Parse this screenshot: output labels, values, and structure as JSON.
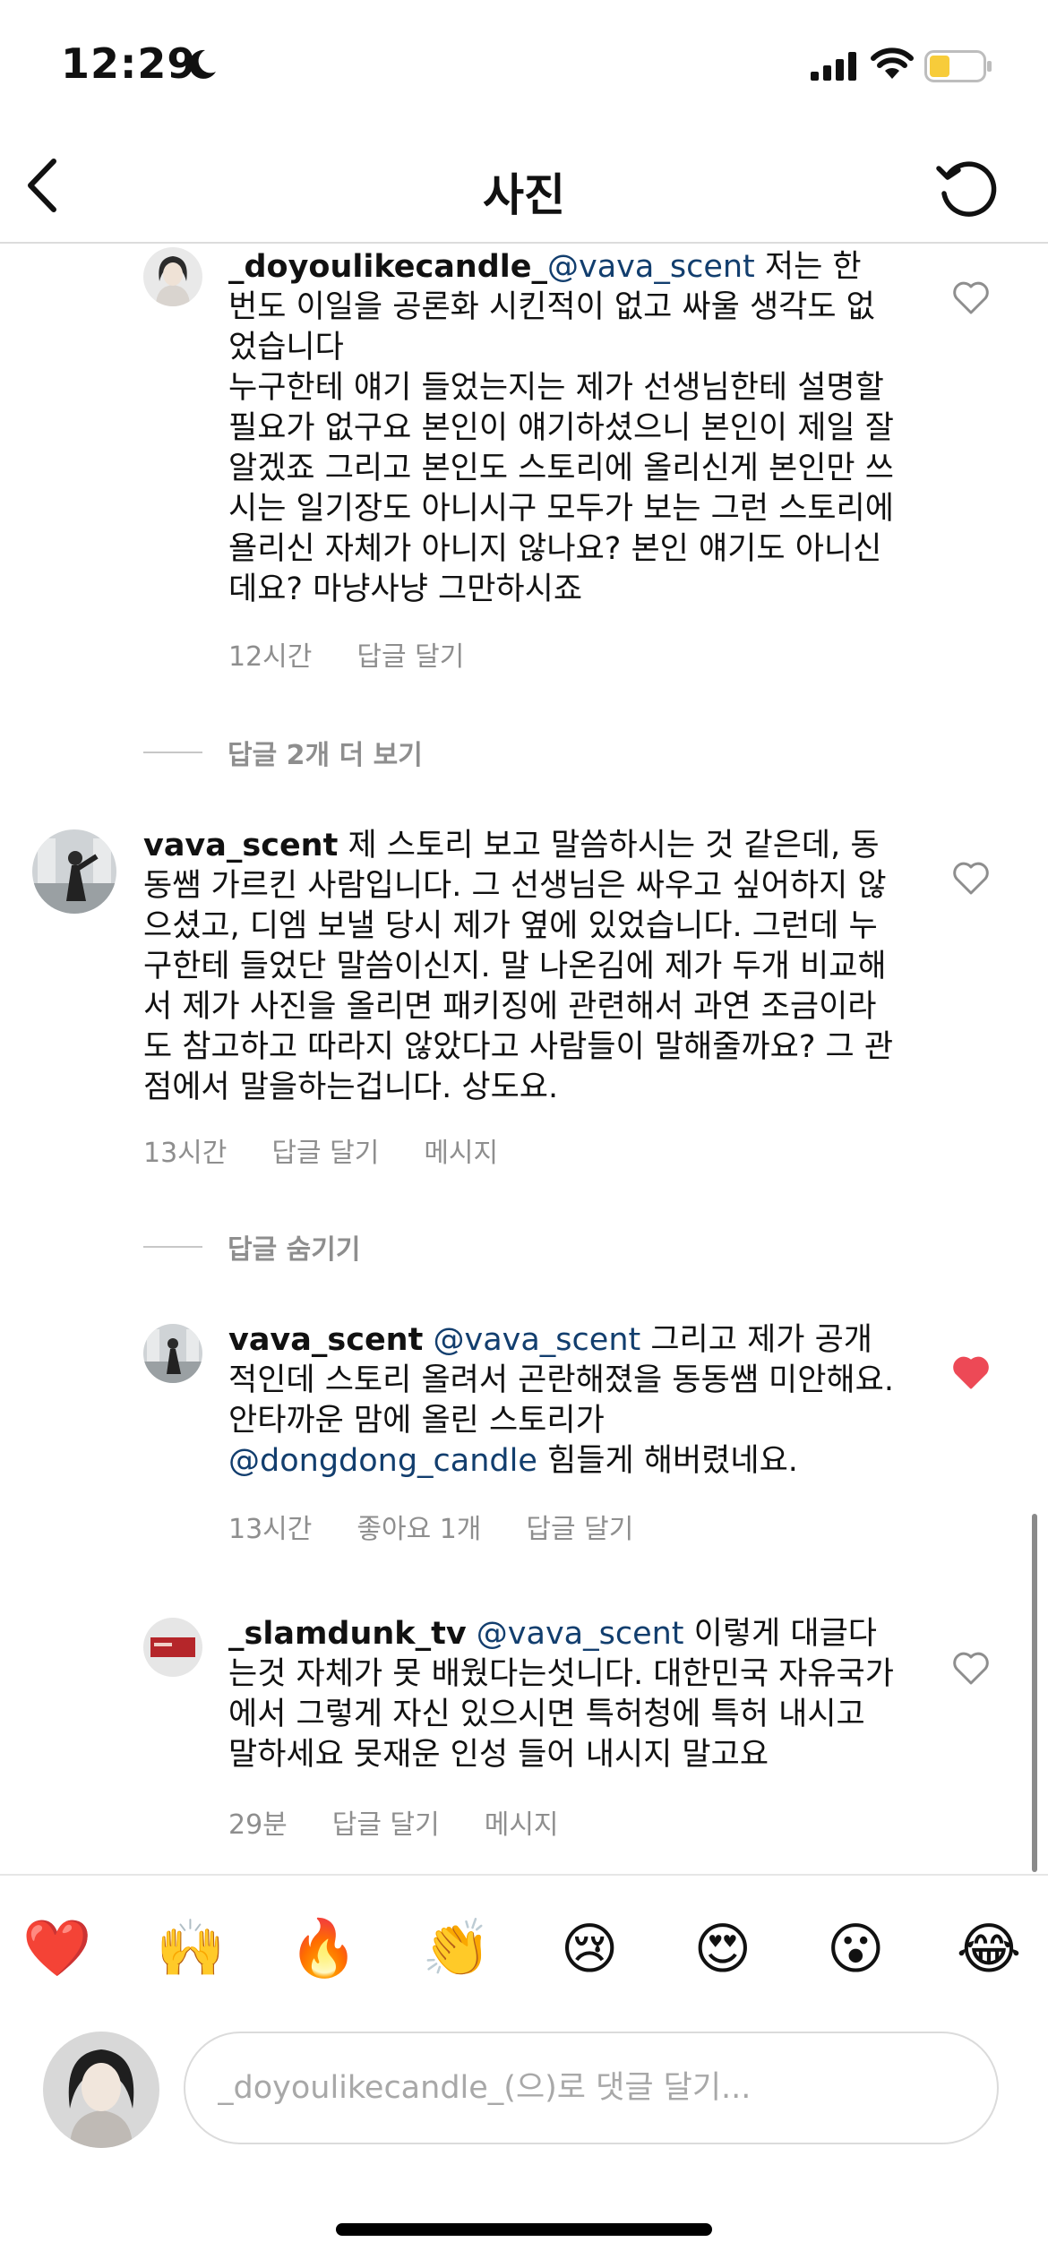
{
  "status_bar": {
    "time": "12:29"
  },
  "nav": {
    "title": "사진"
  },
  "comments": [
    {
      "username": "_doyoulikecandle_",
      "mention": "@vava_scent",
      "text_line1": " 저는 한",
      "text_rest": "번도 이일을 공론화 시킨적이 없고 싸울 생각도 없었습니다",
      "text_para2": "누구한테 얘기 들었는지는 제가 선생님한테 설명할 필요가 없구요 본인이 얘기하셨으니 본인이 제일 잘 알겠죠 그리고 본인도 스토리에 올리신게 본인만 쓰시는 일기장도 아니시구 모두가 보는 그런 스토리에 욜리신 자체가 아니지 않나요? 본인 얘기도 아니신데요? 마냥사냥 그만하시죠",
      "time": "12시간",
      "reply_label": "답글 달기",
      "liked": false
    },
    {
      "username": "vava_scent",
      "text": " 제 스토리 보고 말씀하시는 것 같은데, 동동쌤 가르킨 사람입니다. 그 선생님은 싸우고 싶어하지 않으셨고, 디엠 보낼 당시 제가 옆에 있었습니다. 그런데 누구한테 들었단 말씀이신지. 말 나온김에 제가 두개 비교해서 제가 사진을 올리면 패키징에 관련해서 과연 조금이라도 참고하고 따라지 않았다고 사람들이 말해줄까요? 그 관점에서 말을하는겁니다. 상도요.",
      "time": "13시간",
      "reply_label": "답글 달기",
      "message_label": "메시지",
      "liked": false
    },
    {
      "username": "vava_scent",
      "mention": "@vava_scent",
      "text": " 그리고 제가 공개적인데 스토리 올려서 곤란해졌을 동동쌤 미안해요. 안타까운 맘에 올린 스토리가 ",
      "mention2": "@dongdong_candle",
      "text2": " 힘들게 해버렸네요.",
      "time": "13시간",
      "likes_label": "좋아요 1개",
      "reply_label": "답글 달기",
      "liked": true
    },
    {
      "username": "_slamdunk_tv",
      "mention": "@vava_scent",
      "text": " 이렇게 대글다는것 자체가 못 배웠다는섯니다. 대한민국 자유국가에서 그렇게 자신 있으시면 특허청에 특허 내시고 말하세요 못재운 인성 들어 내시지 말고요",
      "time": "29분",
      "reply_label": "답글 달기",
      "message_label": "메시지",
      "liked": false
    }
  ],
  "reply_toggles": {
    "view_more": "답글 2개 더 보기",
    "hide": "답글 숨기기"
  },
  "emoji_bar": [
    "❤️",
    "🙌",
    "🔥",
    "👏",
    "😢",
    "😍",
    "😮",
    "😂"
  ],
  "composer": {
    "placeholder": "_doyoulikecandle_(으)로 댓글 달기..."
  },
  "colors": {
    "mention": "#123e6e",
    "liked_heart": "#ed4956",
    "meta": "#8e8e8e"
  }
}
